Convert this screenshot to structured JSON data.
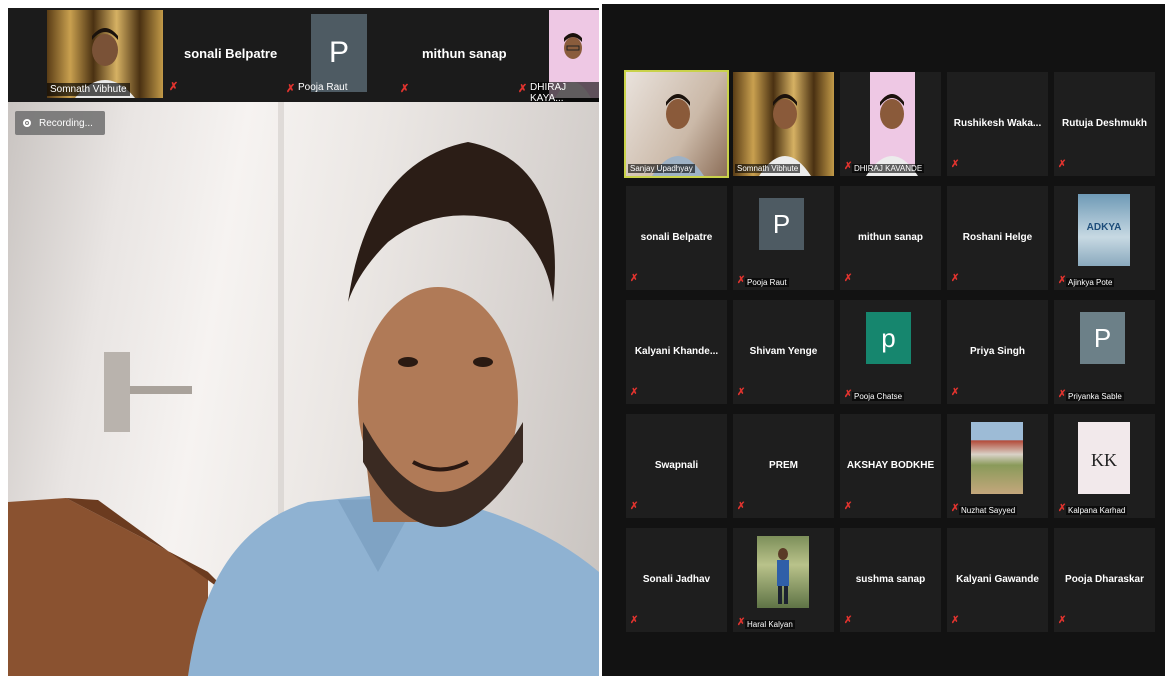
{
  "speaker_view": {
    "top_strip": [
      {
        "name": "Somnath Vibhute",
        "type": "video"
      },
      {
        "name": "sonali Belpatre",
        "type": "name-only"
      },
      {
        "name": "Pooja Raut",
        "type": "avatar",
        "initial": "P"
      },
      {
        "name": "mithun sanap",
        "type": "name-only"
      },
      {
        "name": "DHIRAJ KAYA...",
        "type": "video"
      }
    ],
    "recording_label": "Recording..."
  },
  "gallery_view": {
    "tiles": [
      {
        "name": "Sanjay Upadhyay",
        "type": "video",
        "active": true
      },
      {
        "name": "Somnath Vibhute",
        "type": "video"
      },
      {
        "name": "DHIRAJ KAVANDE",
        "type": "video"
      },
      {
        "name": "Rushikesh Waka...",
        "type": "name-only"
      },
      {
        "name": "Rutuja Deshmukh",
        "type": "name-only"
      },
      {
        "name": "sonali Belpatre",
        "type": "name-only"
      },
      {
        "name": "Pooja Raut",
        "type": "avatar",
        "initial": "P",
        "color": "#4e5b63"
      },
      {
        "name": "mithun sanap",
        "type": "name-only"
      },
      {
        "name": "Roshani Helge",
        "type": "name-only"
      },
      {
        "name": "Ajinkya Pote",
        "type": "image",
        "image_text": "ADKYA"
      },
      {
        "name": "Kalyani Khande...",
        "type": "name-only"
      },
      {
        "name": "Shivam Yenge",
        "type": "name-only"
      },
      {
        "name": "Pooja Chatse",
        "type": "avatar",
        "initial": "p",
        "color": "#16866e"
      },
      {
        "name": "Priya Singh",
        "type": "name-only"
      },
      {
        "name": "Priyanka Sable",
        "type": "avatar",
        "initial": "P",
        "color": "#6c8088"
      },
      {
        "name": "Swapnali",
        "type": "name-only"
      },
      {
        "name": "PREM",
        "type": "name-only"
      },
      {
        "name": "AKSHAY BODKHE",
        "type": "name-only"
      },
      {
        "name": "Nuzhat Sayyed",
        "type": "image"
      },
      {
        "name": "Kalpana Karhad",
        "type": "image",
        "image_text": "KK"
      },
      {
        "name": "Sonali Jadhav",
        "type": "name-only"
      },
      {
        "name": "Haral Kalyan",
        "type": "image"
      },
      {
        "name": "sushma sanap",
        "type": "name-only"
      },
      {
        "name": "Kalyani Gawande",
        "type": "name-only"
      },
      {
        "name": "Pooja Dharaskar",
        "type": "name-only"
      }
    ]
  },
  "colors": {
    "mute": "#e0332e",
    "active_border": "#c9d24a",
    "tile_bg": "#1e1e1e",
    "panel_bg": "#121212"
  }
}
